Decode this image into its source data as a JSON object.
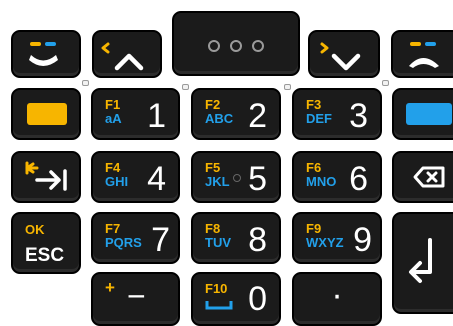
{
  "colors": {
    "key_bg": "#1b1b1b",
    "fn_yellow": "#f7b500",
    "sub_blue": "#22a0ea",
    "glyph_white": "#ffffff"
  },
  "icons": {
    "call_accept": "phone-accept-icon",
    "call_end": "phone-end-icon",
    "up": "chevron-up-icon",
    "down": "chevron-down-icon",
    "menu": "three-dots-icon",
    "tab": "tab-icon",
    "backspace": "backspace-icon",
    "enter": "enter-icon"
  },
  "keys": {
    "k1": {
      "fn": "F1",
      "sub": "aA",
      "num": "1"
    },
    "k2": {
      "fn": "F2",
      "sub": "ABC",
      "num": "2"
    },
    "k3": {
      "fn": "F3",
      "sub": "DEF",
      "num": "3"
    },
    "k4": {
      "fn": "F4",
      "sub": "GHI",
      "num": "4"
    },
    "k5": {
      "fn": "F5",
      "sub": "JKL",
      "num": "5"
    },
    "k6": {
      "fn": "F6",
      "sub": "MNO",
      "num": "6"
    },
    "k7": {
      "fn": "F7",
      "sub": "PQRS",
      "num": "7"
    },
    "k8": {
      "fn": "F8",
      "sub": "TUV",
      "num": "8"
    },
    "k9": {
      "fn": "F9",
      "sub": "WXYZ",
      "num": "9"
    },
    "k0": {
      "fn": "F10",
      "num": "0"
    },
    "esc": {
      "top": "OK",
      "label": "ESC"
    },
    "minus": {
      "top": "+",
      "label": "−"
    },
    "dot": {
      "label": "·"
    }
  }
}
